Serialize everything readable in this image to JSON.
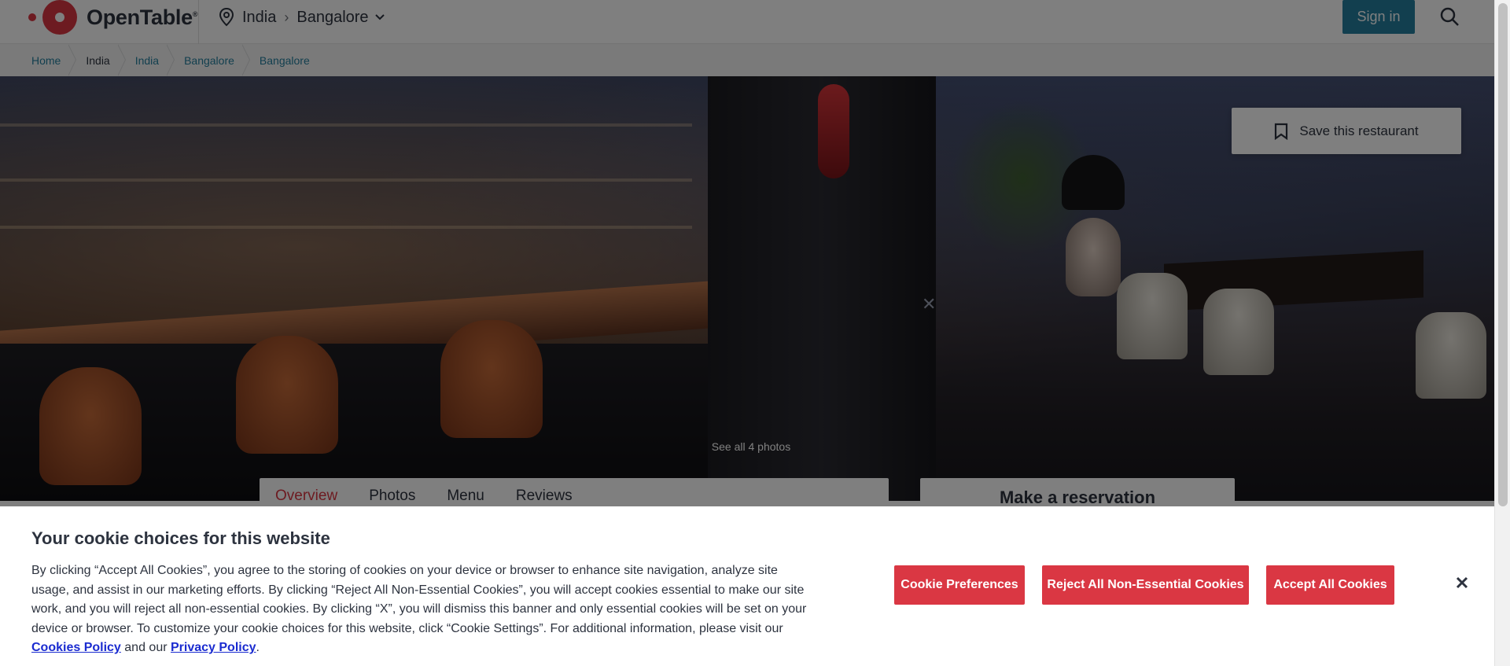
{
  "header": {
    "brand": "OpenTable",
    "brand_reg": "®",
    "location": {
      "country": "India",
      "city": "Bangalore"
    },
    "sign_in_label": "Sign in"
  },
  "breadcrumbs": [
    "Home",
    "India",
    "India",
    "Bangalore",
    "Bangalore"
  ],
  "hero": {
    "save_label": "Save this restaurant",
    "see_photos_label": "See all 4 photos"
  },
  "tabs": [
    "Overview",
    "Photos",
    "Menu",
    "Reviews"
  ],
  "reservation_title": "Make a reservation",
  "cookie_banner": {
    "title": "Your cookie choices for this website",
    "body": "By clicking “Accept All Cookies”, you agree to the storing of cookies on your device or browser to enhance site navigation, analyze site usage, and assist in our marketing efforts. By clicking “Reject All Non-Essential Cookies”, you will accept cookies essential to make our site work, and you will reject all non-essential cookies. By clicking “X”, you will dismiss this banner and only essential cookies will be set on your device or browser. To customize your cookie choices for this website, click “Cookie Settings”. For additional information, please visit our ",
    "cookies_policy_link": "Cookies Policy",
    "and_our": " and our ",
    "privacy_policy_link": "Privacy Policy",
    "end": ".",
    "buttons": {
      "preferences": "Cookie Preferences",
      "reject": "Reject All Non-Essential Cookies",
      "accept": "Accept All Cookies"
    }
  },
  "colors": {
    "brand_red": "#da3743",
    "sign_in_blue": "#247f9e",
    "link_blue": "#1a2bd0"
  }
}
